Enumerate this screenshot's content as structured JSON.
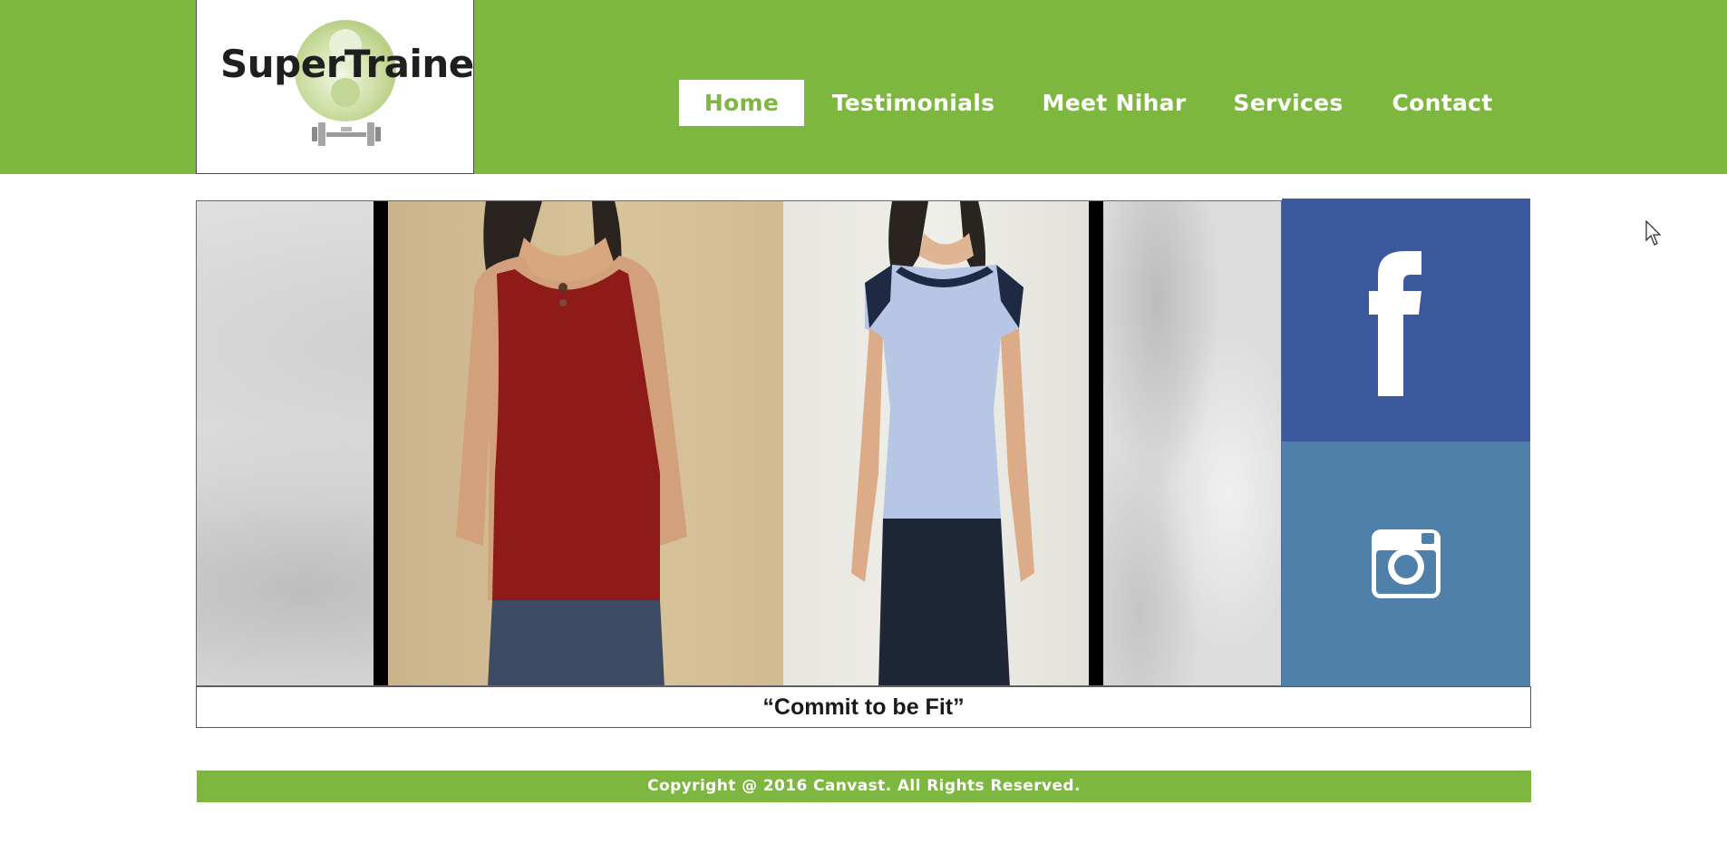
{
  "site": {
    "logo_text": "SuperTrainer"
  },
  "nav": {
    "items": [
      {
        "label": "Home",
        "active": true
      },
      {
        "label": "Testimonials",
        "active": false
      },
      {
        "label": "Meet Nihar",
        "active": false
      },
      {
        "label": "Services",
        "active": false
      },
      {
        "label": "Contact",
        "active": false
      }
    ]
  },
  "hero": {
    "image": "before-after-weight-loss-photo",
    "quote": "“Commit to be Fit”"
  },
  "social": {
    "facebook_icon": "facebook-icon",
    "instagram_icon": "instagram-icon"
  },
  "footer": {
    "copyright": "Copyright @ 2016 Canvast. All Rights Reserved."
  },
  "colors": {
    "brand_green": "#7db73f",
    "facebook_blue": "#3b579d",
    "instagram_blue": "#4f80a9"
  }
}
